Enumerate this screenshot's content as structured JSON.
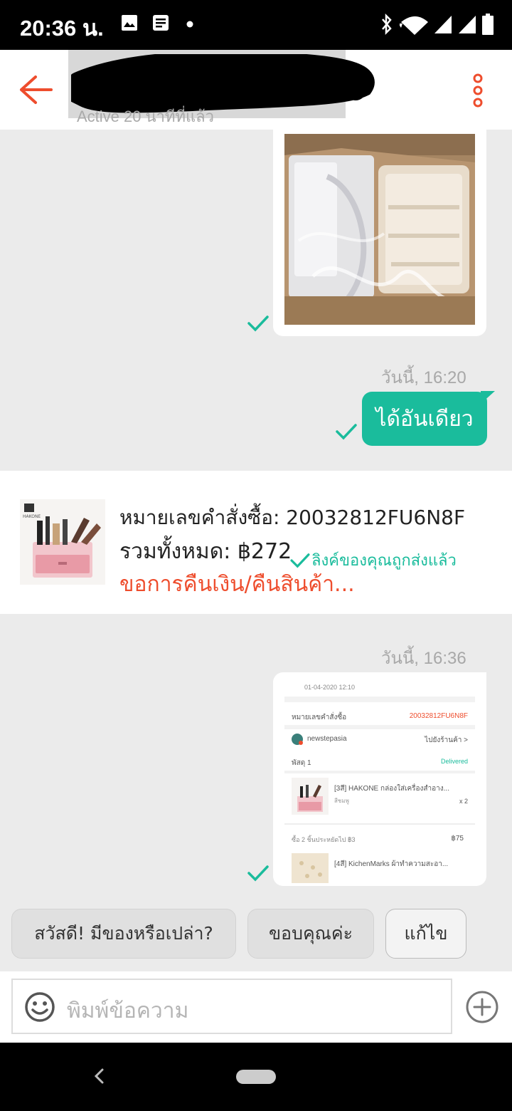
{
  "status_bar": {
    "time": "20:36 น.",
    "icons": [
      "image-icon",
      "message-icon",
      "dot-icon",
      "bluetooth-icon",
      "wifi-icon",
      "signal-icon",
      "signal-icon",
      "battery-icon"
    ]
  },
  "header": {
    "active_status": "Active 20 นาทีที่แล้ว",
    "back_icon": "arrow-left-icon",
    "menu_icon": "more-vertical-icon",
    "accent": "#ee4d2d"
  },
  "messages": [
    {
      "type": "image",
      "content": "photo of box with plastic organizer",
      "status": "sent"
    },
    {
      "type": "timestamp",
      "text": "วันนี้, 16:20"
    },
    {
      "type": "text",
      "text": "ได้อันเดียว",
      "status": "sent"
    },
    {
      "type": "timestamp",
      "text": "วันนี้, 16:36"
    },
    {
      "type": "image",
      "content": "order screenshot",
      "status": "sent"
    }
  ],
  "order_card": {
    "order_number": "หมายเลขคำสั่งซื้อ: 20032812FU6N8F",
    "total": "รวมทั้งหมด: ฿272",
    "action": "ขอการคืนเงิน/คืนสินค้า...",
    "link_status": "ลิงค์ของคุณถูกส่งแล้ว",
    "thumb_brand": "HAKONE"
  },
  "order_screenshot": {
    "date": "01-04-2020 12:10",
    "order_label": "หมายเลขคำสั่งซื้อ",
    "order_id": "20032812FU6N8F",
    "shop_name": "newstepasia",
    "shop_link": "ไปยังร้านค้า >",
    "parcel": "พัสดุ 1",
    "parcel_status": "Delivered",
    "item1": "[3สี] HAKONE กล่องใส่เครื่องสำอาง...",
    "item1_variant": "สีชมพู",
    "item1_qty": "x 2",
    "discount_row": "ซื้อ 2 ชิ้นประหยัดไป ฿3",
    "discount_price": "฿75",
    "item2": "[4สี] KichenMarks ผ้าทำความสะอา..."
  },
  "quick_replies": [
    "สวัสดี! มีของหรือเปล่า?",
    "ขอบคุณค่ะ",
    "แก้ไข"
  ],
  "input": {
    "placeholder": "พิมพ์ข้อความ",
    "emoji_icon": "smiley-icon",
    "plus_icon": "plus-circle-icon"
  },
  "colors": {
    "brand": "#ee4d2d",
    "sent_bubble": "#1abc9c",
    "tick": "#1abc9c"
  }
}
